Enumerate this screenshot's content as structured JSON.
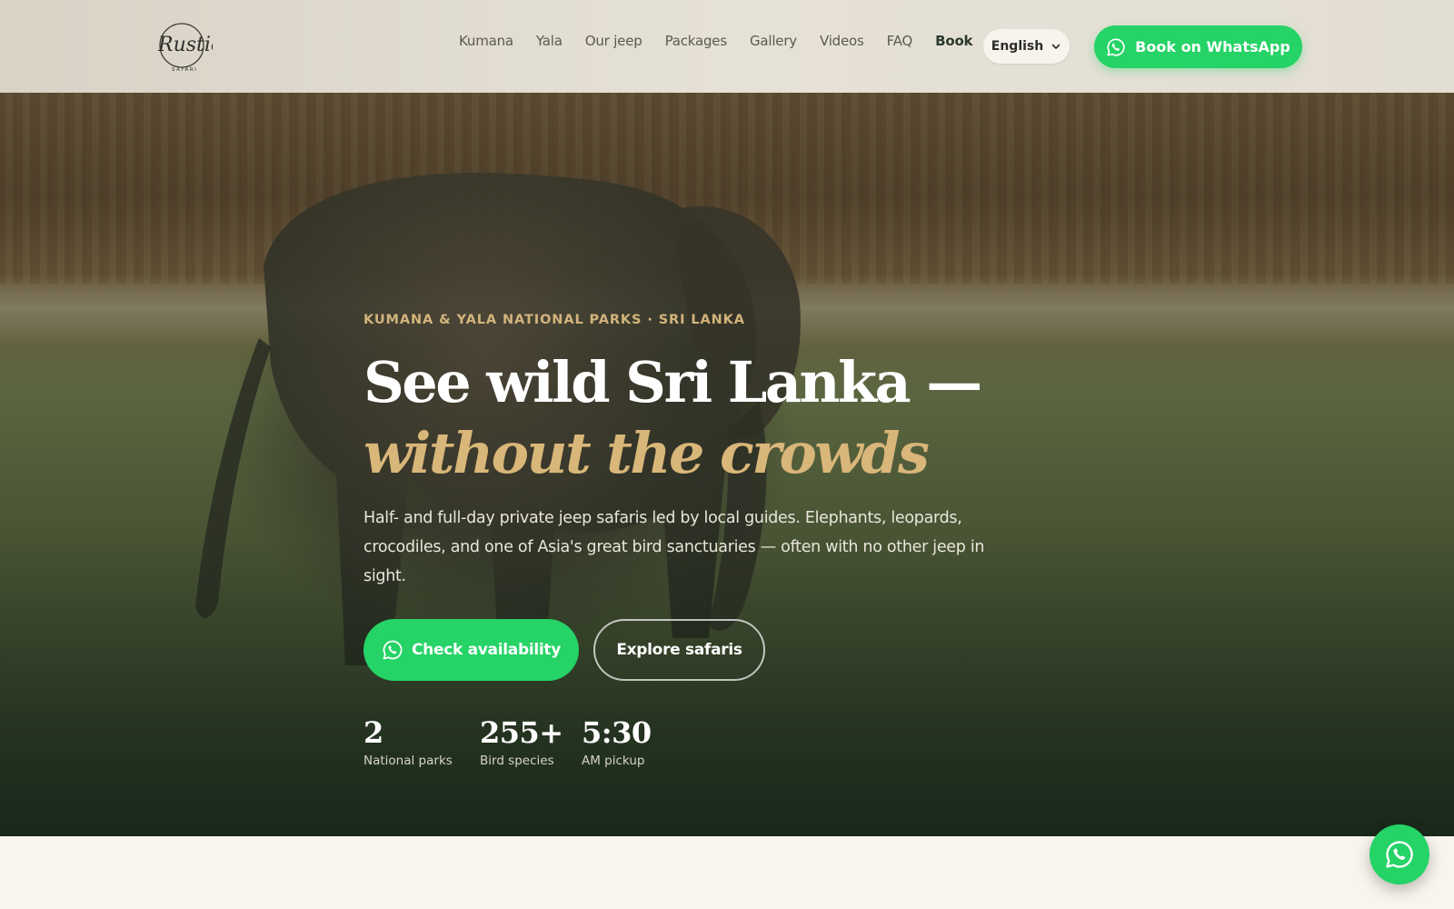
{
  "brand": {
    "logo_script": "Rustic",
    "logo_sub": "SAFARI"
  },
  "nav": {
    "items": [
      {
        "label": "Kumana"
      },
      {
        "label": "Yala"
      },
      {
        "label": "Our jeep"
      },
      {
        "label": "Packages"
      },
      {
        "label": "Gallery"
      },
      {
        "label": "Videos"
      },
      {
        "label": "FAQ"
      },
      {
        "label": "Book"
      }
    ],
    "active": "Book"
  },
  "language": {
    "selected": "English"
  },
  "header_cta": {
    "label": "Book on WhatsApp"
  },
  "hero": {
    "eyebrow": "KUMANA & YALA NATIONAL PARKS · SRI LANKA",
    "title_line1": "See wild Sri Lanka —",
    "title_line2": "without the crowds",
    "lead": "Half- and full-day private jeep safaris led by local guides. Elephants, leopards, crocodiles, and one of Asia's great bird sanctuaries — often with no other jeep in sight.",
    "primary_cta": "Check availability",
    "secondary_cta": "Explore safaris",
    "stats": [
      {
        "value": "2",
        "label": "National parks"
      },
      {
        "value": "255+",
        "label": "Bird species"
      },
      {
        "value": "5:30",
        "label": "AM pickup"
      }
    ]
  },
  "colors": {
    "whatsapp_green": "#25d366",
    "accent_gold": "#d9b679",
    "header_bg": "#e3ded4",
    "page_bg": "#f8f4ee"
  },
  "icons": {
    "whatsapp": "whatsapp-icon",
    "chevron": "chevron-down-icon"
  }
}
